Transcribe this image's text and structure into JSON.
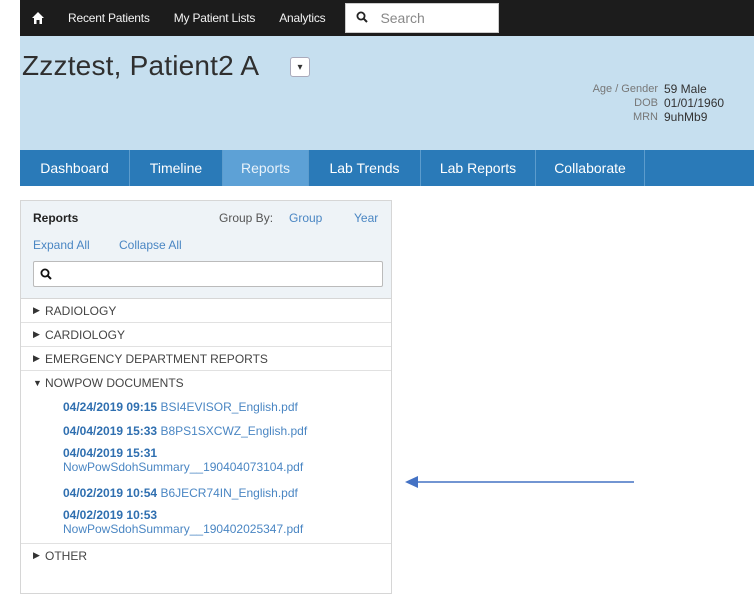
{
  "topnav": {
    "items": [
      "Recent Patients",
      "My Patient Lists",
      "Analytics"
    ],
    "search_placeholder": "Search"
  },
  "patient": {
    "name": "Zzztest, Patient2 A",
    "age_gender_label": "Age / Gender",
    "age_gender": "59 Male",
    "dob_label": "DOB",
    "dob": "01/01/1960",
    "mrn_label": "MRN",
    "mrn": "9uhMb9"
  },
  "tabs": [
    "Dashboard",
    "Timeline",
    "Reports",
    "Lab Trends",
    "Lab Reports",
    "Collaborate"
  ],
  "active_tab": "Reports",
  "reports": {
    "title": "Reports",
    "group_by_label": "Group By:",
    "group_option": "Group",
    "year_option": "Year",
    "expand_all": "Expand All",
    "collapse_all": "Collapse All",
    "categories": [
      {
        "label": "RADIOLOGY",
        "expanded": false
      },
      {
        "label": "CARDIOLOGY",
        "expanded": false
      },
      {
        "label": "EMERGENCY DEPARTMENT REPORTS",
        "expanded": false
      },
      {
        "label": "NOWPOW DOCUMENTS",
        "expanded": true
      },
      {
        "label": "OTHER",
        "expanded": false
      }
    ],
    "documents": [
      {
        "datetime": "04/24/2019 09:15",
        "file": "BSI4EVISOR_English.pdf"
      },
      {
        "datetime": "04/04/2019 15:33",
        "file": "B8PS1SXCWZ_English.pdf"
      },
      {
        "datetime": "04/04/2019 15:31",
        "file": "NowPowSdohSummary__190404073104.pdf"
      },
      {
        "datetime": "04/02/2019 10:54",
        "file": "B6JECR74IN_English.pdf"
      },
      {
        "datetime": "04/02/2019 10:53",
        "file": "NowPowSdohSummary__190402025347.pdf"
      }
    ]
  },
  "colors": {
    "topnav": "#1c1c1c",
    "header_bg": "#c6dfef",
    "tabs_bg": "#2a7ab8",
    "active_tab": "#5da1d6",
    "link": "#4a86c3",
    "annotation_arrow": "#4472c4"
  }
}
